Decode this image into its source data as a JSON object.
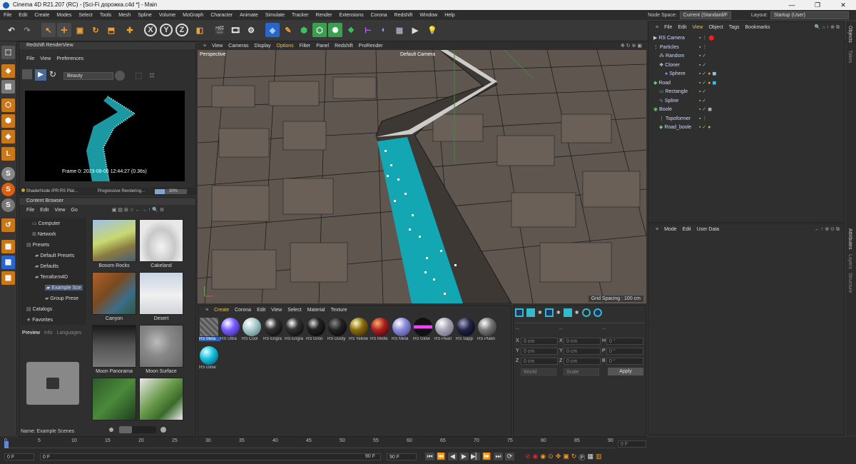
{
  "window": {
    "title": "Cinema 4D R21.207 (RC) - [Sci-Fi дорожка.c4d *] - Main",
    "controls": [
      "—",
      "❐",
      "✕"
    ]
  },
  "menu": [
    "File",
    "Edit",
    "Create",
    "Modes",
    "Select",
    "Tools",
    "Mesh",
    "Spline",
    "Volume",
    "MoGraph",
    "Character",
    "Animate",
    "Simulate",
    "Tracker",
    "Render",
    "Extensions",
    "Corona",
    "Redshift",
    "Window",
    "Help"
  ],
  "menu_right": {
    "node_space_label": "Node Space:",
    "node_space_value": "Current (Standard/F",
    "layout_label": "Layout:",
    "layout_value": "Startup (User)"
  },
  "render_view": {
    "title": "Redshift RenderView",
    "menu": [
      "File",
      "View",
      "Preferences"
    ],
    "aov": "Beauty",
    "frame_text": "Frame  0:  2023-08-06  12:44:27  (0.36s)",
    "status_left": "ShaderNode IPR:RS Plat...",
    "status_right": "Progressive Rendering...",
    "progress_pct": "30%",
    "progress": 0.3
  },
  "content_browser": {
    "title": "Content Browser",
    "menu": [
      "File",
      "Edit",
      "View",
      "Go"
    ],
    "tree": [
      "Computer",
      "Network",
      "Presets",
      "Default Presets",
      "Defaults",
      "Terraform4D",
      "Example Sce",
      "Group Prese",
      "Catalogs",
      "Favorites"
    ],
    "thumbnails": [
      "Bosom Rocks",
      "Cakeland",
      "Canyon",
      "Desert",
      "Moon Panorama",
      "Moon Surface",
      "",
      ""
    ],
    "preview_tabs": [
      "Preview",
      "Info",
      "Languages"
    ],
    "name_label": "Name:  Example Scenes"
  },
  "viewport": {
    "menu": [
      "View",
      "Cameras",
      "Display",
      "Options",
      "Filter",
      "Panel",
      "Redshift",
      "ProRender"
    ],
    "perspective": "Perspective",
    "camera": "Default Camera",
    "grid_spacing": "Grid Spacing : 100 cm"
  },
  "object_manager": {
    "menu": [
      "File",
      "Edit",
      "View",
      "Object",
      "Tags",
      "Bookmarks"
    ],
    "objects": [
      "RS Camera",
      "Particles",
      "Random",
      "Cloner",
      "Sphere",
      "Road",
      "Rectangle",
      "Spline",
      "Boole",
      "Topoformer",
      "Road_boole"
    ]
  },
  "attributes": {
    "menu": [
      "Mode",
      "Edit",
      "User Data"
    ]
  },
  "material_manager": {
    "menu": [
      "Create",
      "Corona",
      "Edit",
      "View",
      "Select",
      "Material",
      "Texture"
    ],
    "materials": [
      "RS Meta",
      "RS Ultra",
      "RS Cool",
      "RS Engra",
      "RS Engra",
      "RS Groo",
      "RS Dusty",
      "RS Yellow",
      "RS Molte",
      "RS Meta",
      "RS Glow",
      "RS Pearl",
      "RS Sapp",
      "RS Platin",
      "RS Glow"
    ]
  },
  "coordinates": {
    "labels": [
      "X",
      "Y",
      "Z",
      "X",
      "Y",
      "Z",
      "H",
      "P",
      "B"
    ],
    "values": [
      "0 cm",
      "0 cm",
      "0 cm",
      "0 cm",
      "0 cm",
      "0 cm",
      "0 °",
      "0 °",
      "0 °"
    ],
    "world": "World",
    "scale": "Scale",
    "apply": "Apply"
  },
  "timeline": {
    "ticks": [
      "0",
      "5",
      "10",
      "15",
      "20",
      "25",
      "30",
      "35",
      "40",
      "45",
      "50",
      "55",
      "60",
      "65",
      "70",
      "75",
      "80",
      "85",
      "90"
    ],
    "current_frame": "0 F",
    "start": "0 F",
    "min": "0 F",
    "max": "90 F",
    "end": "90 F"
  },
  "side_tabs": [
    "Objects",
    "Takes",
    "Attributes",
    "Layers",
    "Structure"
  ],
  "colors": {
    "accent": "#2a66c9",
    "particles": "#1aa8b5",
    "check": "#7cd36b"
  }
}
